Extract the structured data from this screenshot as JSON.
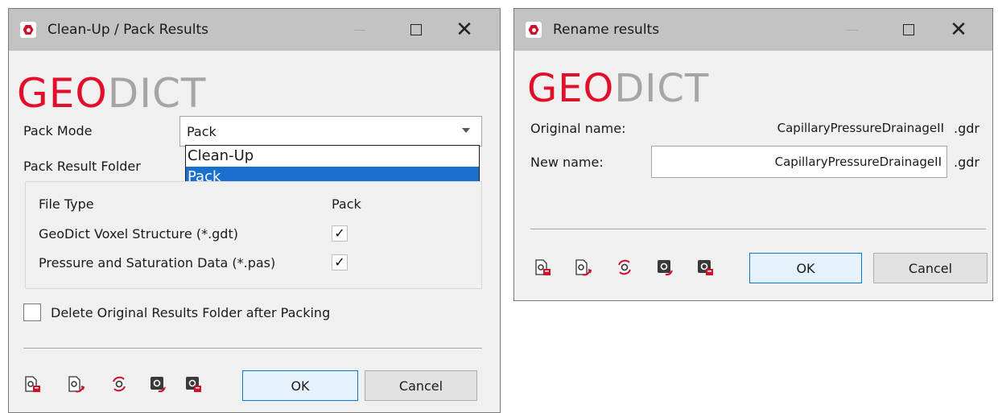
{
  "pack_dialog": {
    "title": "Clean-Up / Pack Results",
    "logo": {
      "geo": "Geo",
      "dict": "Dict"
    },
    "pack_mode_label": "Pack Mode",
    "pack_mode_value": "Pack",
    "dropdown_options": [
      "Clean-Up",
      "Pack"
    ],
    "dropdown_selected": "Pack",
    "result_folder_label": "Pack Result Folder",
    "table": {
      "col_file_type": "File Type",
      "col_pack": "Pack",
      "rows": [
        {
          "file_type": "GeoDict Voxel Structure (*.gdt)",
          "checked": true
        },
        {
          "file_type": "Pressure and Saturation Data (*.pas)",
          "checked": true
        }
      ]
    },
    "delete_option_label": "Delete Original Results Folder after Packing",
    "delete_option_checked": false,
    "ok_label": "OK",
    "cancel_label": "Cancel"
  },
  "rename_dialog": {
    "title": "Rename results",
    "logo": {
      "geo": "Geo",
      "dict": "Dict"
    },
    "original_name_label": "Original name:",
    "original_name_value": "CapillaryPressureDrainageII",
    "original_ext": ".gdr",
    "new_name_label": "New name:",
    "new_name_value": "CapillaryPressureDrainageII",
    "new_ext": ".gdr",
    "ok_label": "OK",
    "cancel_label": "Cancel"
  },
  "colors": {
    "brand_red": "#e1102a",
    "brand_grey": "#a5a5a5",
    "selection_blue": "#1a6fcf",
    "titlebar": "#c3c3c3"
  },
  "icons": [
    "load-settings-icon",
    "save-settings-icon",
    "reset-settings-icon",
    "load-macro-icon",
    "save-macro-icon"
  ]
}
